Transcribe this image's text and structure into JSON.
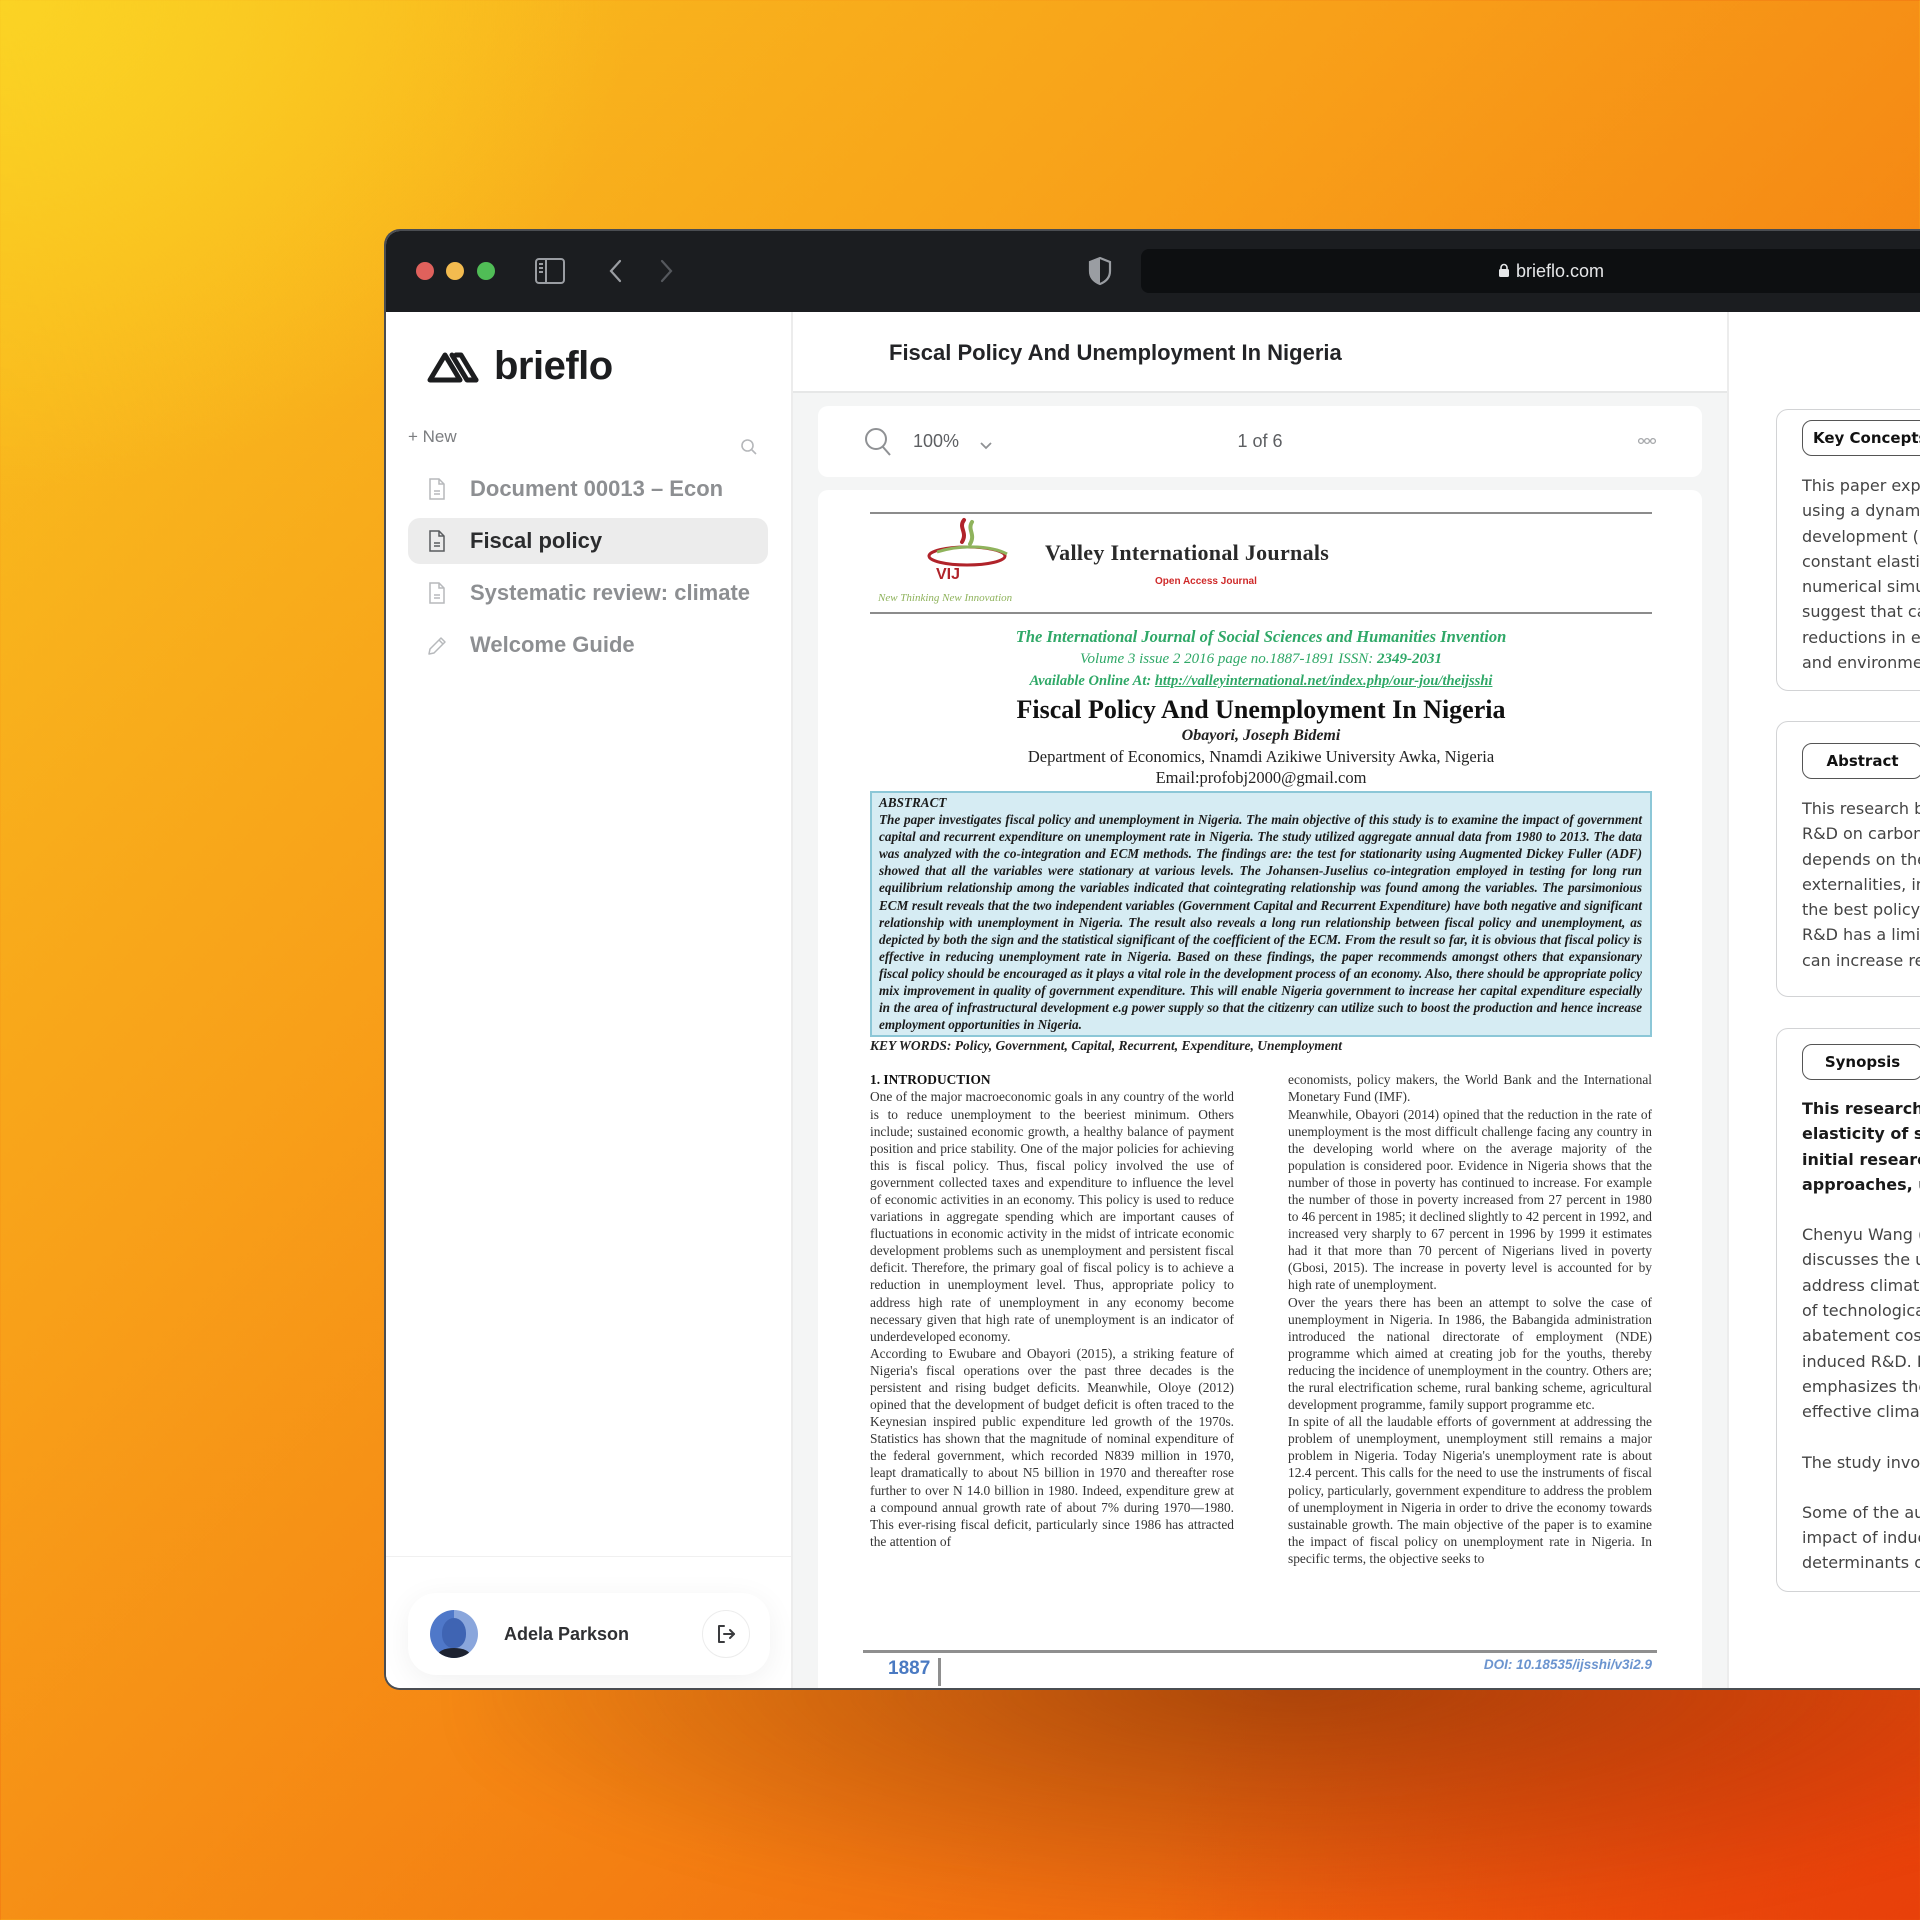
{
  "browser": {
    "url": "brieflo.com",
    "buttons": {
      "sidebar_toggle": "sidebar-toggle",
      "back": "back",
      "forward": "forward",
      "reload": "reload"
    }
  },
  "sidebar": {
    "brand": "brieflo",
    "new_label": "+ New",
    "documents": [
      {
        "label": "Document 00013 – Econ",
        "icon": "document-icon",
        "active": false
      },
      {
        "label": "Fiscal policy",
        "icon": "document-icon",
        "active": true
      },
      {
        "label": "Systematic review: climate",
        "icon": "document-icon",
        "active": false
      },
      {
        "label": "Welcome Guide",
        "icon": "pencil-icon",
        "active": false
      }
    ],
    "user": {
      "name": "Adela Parkson"
    }
  },
  "main": {
    "title": "Fiscal Policy And Unemployment In Nigeria",
    "toolbar": {
      "zoom": "100%",
      "page_indicator": "1 of 6"
    },
    "pdf": {
      "publisher": "Valley International  Journals",
      "logo_text": "VIJ",
      "logo_tagline": "New Thinking New Innovation",
      "open_access": "Open Access Journal",
      "journal_name": "The International Journal of Social Sciences and Humanities Invention",
      "volume_line": "Volume 3 issue 2 2016 page no.1887-1891 ISSN: ",
      "issn": "2349-2031",
      "available_label": "Available Online At: ",
      "available_url": "http://valleyinternational.net/index.php/our-jou/theijsshi",
      "paper_title": "Fiscal Policy And Unemployment In Nigeria",
      "author": "Obayori, Joseph Bidemi",
      "affiliation": "Department of Economics, Nnamdi Azikiwe University Awka, Nigeria",
      "email": "Email:profobj2000@gmail.com",
      "abstract_heading": "ABSTRACT",
      "abstract": "The paper investigates fiscal policy and unemployment in Nigeria. The main objective of this study is to examine the impact of government capital and recurrent expenditure on unemployment rate in Nigeria. The study utilized aggregate annual data from 1980 to 2013. The data was analyzed with the co-integration and ECM methods. The findings are: the test for stationarity using Augmented Dickey Fuller (ADF) showed that all the variables were stationary at various levels. The Johansen-Juselius co-integration employed in testing for long run equilibrium relationship among the variables indicated that cointegrating relationship was found among the variables. The parsimonious ECM result reveals that the two independent variables (Government Capital and Recurrent Expenditure) have both negative and significant relationship with unemployment in Nigeria. The result also reveals a long run relationship between fiscal policy and unemployment, as depicted by both the sign and the statistical significant of the coefficient of the ECM.  From the result so far, it is obvious that fiscal policy is effective in reducing unemployment rate in Nigeria. Based on these findings, the paper recommends amongst others that expansionary fiscal policy should be encouraged as it plays a vital role in the development process of an economy. Also, there should be appropriate policy mix improvement in quality of government expenditure. This will enable Nigeria government to increase her capital expenditure especially in the area of infrastructural development e.g power supply so that the citizenry can utilize such to boost the production and hence increase employment opportunities in Nigeria.",
      "keywords": "KEY WORDS: Policy, Government, Capital, Recurrent, Expenditure, Unemployment",
      "section_heading": "1. INTRODUCTION",
      "left_column": [
        "One of the major macroeconomic goals in any country of the world is to reduce unemployment to the beeriest minimum. Others include; sustained economic growth, a healthy balance of payment position and price stability. One of the major policies for achieving this is fiscal policy. Thus, fiscal policy involved the use of government collected taxes and expenditure to influence the level of economic activities in an economy. This policy is used to reduce variations in aggregate spending which are important causes of fluctuations in economic activity in the midst of intricate economic development problems such as unemployment and persistent fiscal deficit. Therefore, the primary goal of fiscal policy is to achieve a reduction in unemployment level. Thus, appropriate policy to address high rate of unemployment in any economy become necessary given that high rate of unemployment is an indicator of underdeveloped economy.",
        "According to Ewubare and Obayori (2015), a striking feature of Nigeria's fiscal operations over the past three decades is the persistent and rising budget deficits. Meanwhile, Oloye (2012) opined that the development of budget deficit is often traced to the Keynesian inspired public expenditure led growth of the 1970s. Statistics has shown that the magnitude of nominal expenditure of the federal government, which recorded N839 million in 1970, leapt dramatically to about N5 billion in 1970 and thereafter rose further to over N 14.0 billion in 1980. Indeed, expenditure grew at a compound annual growth rate of about 7% during 1970—1980. This ever-rising fiscal deficit, particularly since 1986 has attracted the attention of"
      ],
      "right_column": [
        "economists, policy makers, the World Bank and the International Monetary Fund (IMF).",
        "Meanwhile, Obayori (2014) opined that the reduction in the rate of unemployment is the most difficult challenge facing any country in the developing world where on the average majority of the population is considered poor. Evidence in Nigeria shows that the number of those in poverty has continued to increase. For example the number of those in poverty increased from 27 percent in 1980 to 46 percent in 1985; it declined slightly to 42 percent in 1992, and increased very sharply to 67 percent in 1996 by 1999 it estimates had it that more than 70 percent of Nigerians lived in poverty (Gbosi, 2015). The increase in poverty level is accounted for by high rate of unemployment.",
        "Over the years there has been an attempt to solve the case of unemployment in Nigeria. In 1986, the Babangida administration introduced the national directorate of employment (NDE) programme which aimed at creating job for the youths, thereby reducing the incidence of unemployment in the country. Others are; the rural electrification scheme, rural banking scheme, agricultural development programme, family support programme etc.",
        "In spite of all the laudable efforts of government at addressing the problem of unemployment, unemployment still remains a major problem in Nigeria. Today Nigeria's unemployment rate is about 12.4 percent. This calls for the need to use the instruments of fiscal policy, particularly, government expenditure to address the problem of unemployment in Nigeria in order to drive the economy towards sustainable growth. The main objective of the paper is to examine the impact of fiscal policy on unemployment rate in Nigeria. In specific terms, the objective seeks to"
      ],
      "page_number": "1887",
      "doi": "DOI: 10.18535/ijsshi/v3i2.9"
    }
  },
  "right_panel": {
    "key_concepts": {
      "tag": "Key Concepts",
      "lines": [
        "This paper expl",
        "using a dynamic",
        "development (R",
        "constant elastic",
        "numerical simul",
        "suggest that ca",
        "reductions in er",
        "and environmer"
      ]
    },
    "abstract": {
      "tag": "Abstract",
      "lines": [
        "This research bu",
        "R&D on carbon",
        "depends on the",
        "externalities, ini",
        "the best policy",
        "R&D has a limite",
        "can increase re"
      ]
    },
    "synopsis": {
      "tag": "Synopsis",
      "bold_lines": [
        "This research s",
        "elasticity of su",
        "initial research",
        "approaches, u"
      ],
      "para2_lines": [
        "Chenyu Wang (",
        "discusses the u",
        "address climate",
        "of technologica",
        "abatement cos",
        "induced R&D. I",
        "emphasizes the",
        "effective clima"
      ],
      "para3_lines": [
        "The study involv"
      ],
      "para4_lines": [
        "Some of the au",
        "impact of induc",
        "determinants o"
      ]
    }
  },
  "colors": {
    "background_top": "#fbd324",
    "background_bottom": "#e8400a",
    "titlebar": "#1b1d20",
    "journal_green": "#2fa867",
    "abstract_fill": "#d6ecf3",
    "doi_blue": "#6b94cf"
  }
}
